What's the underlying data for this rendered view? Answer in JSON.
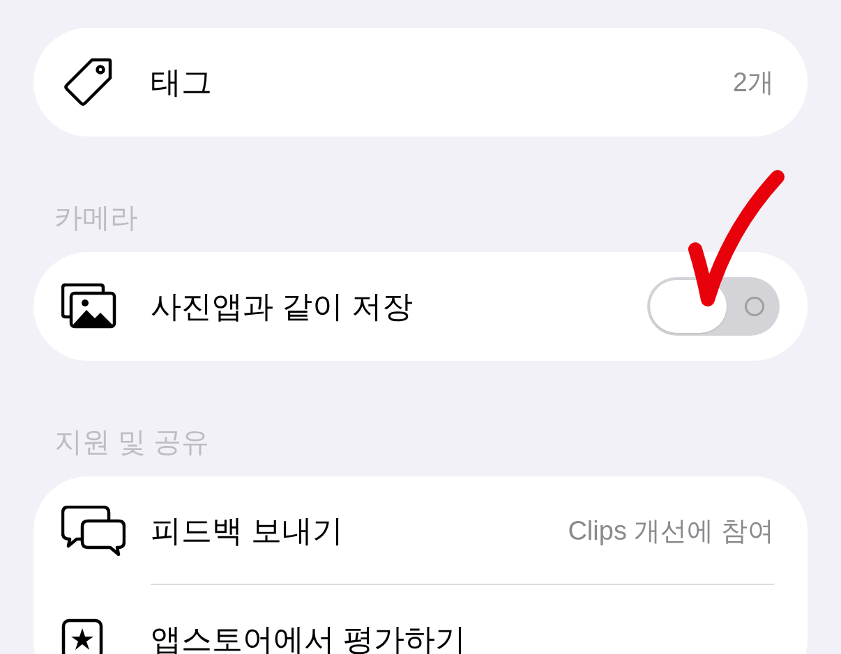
{
  "sections": [
    {
      "rows": [
        {
          "kind": "value",
          "label": "태그",
          "value": "2개"
        }
      ]
    },
    {
      "header": "카메라",
      "rows": [
        {
          "kind": "toggle",
          "label": "사진앱과 같이 저장",
          "on": false
        }
      ]
    },
    {
      "header": "지원 및 공유",
      "rows": [
        {
          "kind": "value",
          "label": "피드백 보내기",
          "value": "Clips 개선에 참여"
        },
        {
          "kind": "link",
          "label": "앱스토어에서 평가하기"
        }
      ]
    }
  ],
  "annotation": {
    "kind": "checkmark"
  }
}
